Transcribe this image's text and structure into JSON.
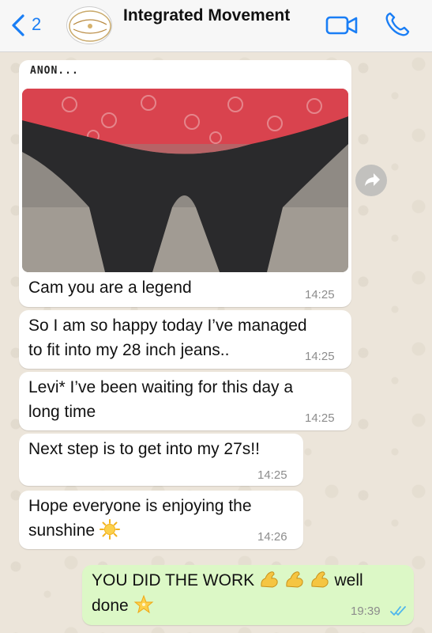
{
  "header": {
    "back_count": "2",
    "title": "Integrated Movement",
    "avatar_text": "Integrated Movement"
  },
  "messages": [
    {
      "sender": "ANON...",
      "image": "photo-jeans",
      "text": "Cam you are a legend",
      "time": "14:25"
    },
    {
      "line1": "So I am so happy today I’ve managed",
      "line2": "to fit into my 28 inch jeans..",
      "time": "14:25"
    },
    {
      "line1": "Levi* I’ve been waiting for this day a",
      "line2": "long time",
      "time": "14:25"
    },
    {
      "text": "Next step is to get into my 27s!!",
      "time": "14:25"
    },
    {
      "line1": "Hope everyone is enjoying the",
      "line2": "sunshine",
      "emoji": "sun-emoji",
      "time": "14:26"
    },
    {
      "line1_a": "YOU DID THE WORK",
      "line1_b": "well",
      "line2": "done",
      "emojis": [
        "flexed-biceps-emoji",
        "flexed-biceps-emoji",
        "flexed-biceps-emoji",
        "glowing-star-emoji"
      ],
      "time": "19:39",
      "status": "read"
    }
  ],
  "colors": {
    "accent": "#1a7ef5",
    "incoming_bubble": "#ffffff",
    "outgoing_bubble": "#dcf8c6",
    "read_ticks": "#4fb6ec",
    "shirt": "#d9444e",
    "jeans": "#2a2a2c"
  }
}
